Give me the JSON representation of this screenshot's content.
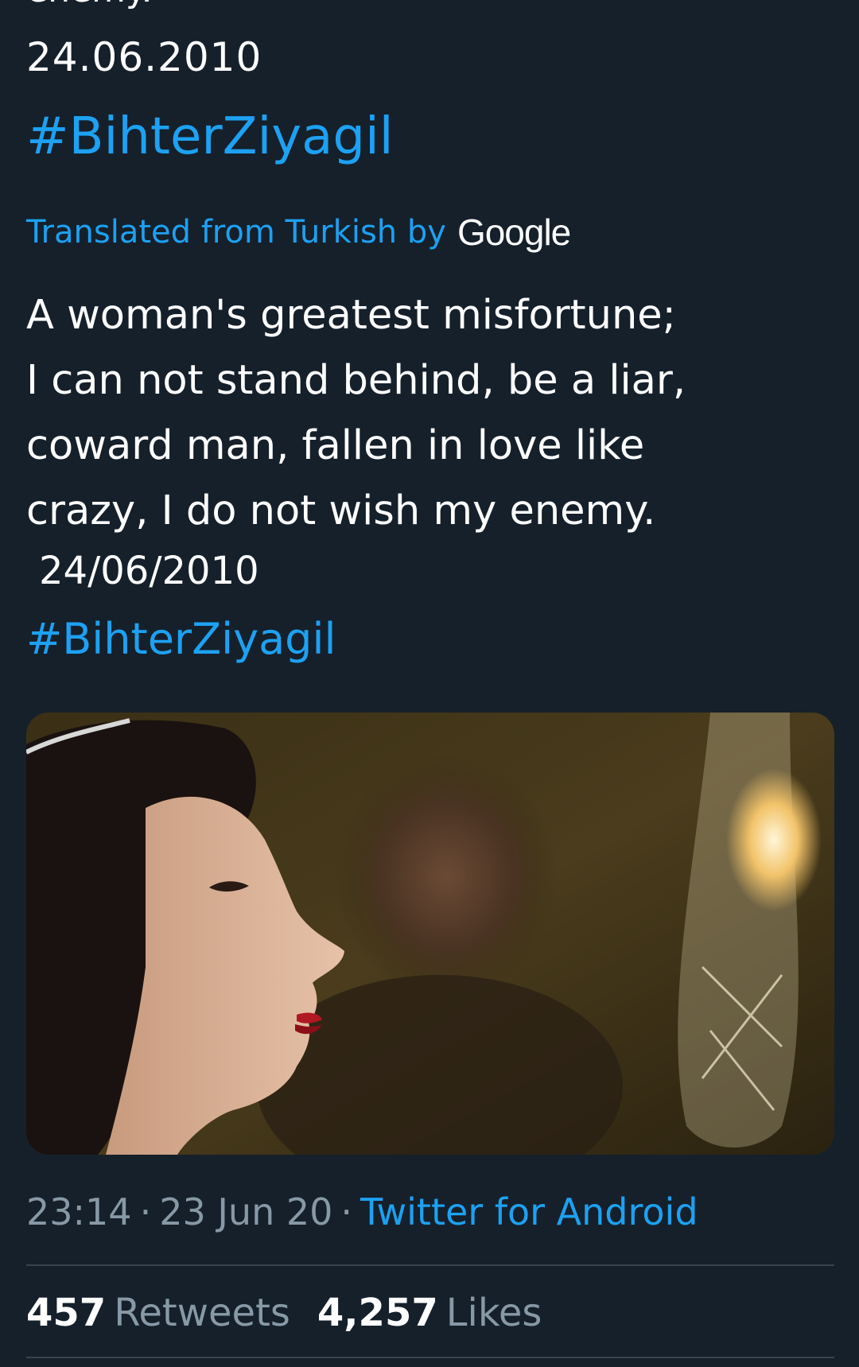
{
  "tweet": {
    "truncated_line": "enemy.",
    "original_date": "24.06.2010",
    "original_hashtag": "#BihterZiyagil",
    "translated_label": "Translated from Turkish by",
    "translator_brand": "Google",
    "translation_lines": [
      "A woman's greatest misfortune;",
      "I can not stand behind, be a liar,",
      "coward man, fallen in love like",
      "crazy, I do not wish my enemy."
    ],
    "translated_date": "24/06/2010",
    "translated_hashtag": "#BihterZiyagil",
    "time": "23:14",
    "separator": "·",
    "date": "23 Jun 20",
    "source": "Twitter for Android",
    "retweets_count": "457",
    "retweets_label": "Retweets",
    "likes_count": "4,257",
    "likes_label": "Likes"
  },
  "colors": {
    "background": "#15202b",
    "link": "#1da1f2",
    "muted": "#8899a6",
    "divider": "#38444d"
  }
}
